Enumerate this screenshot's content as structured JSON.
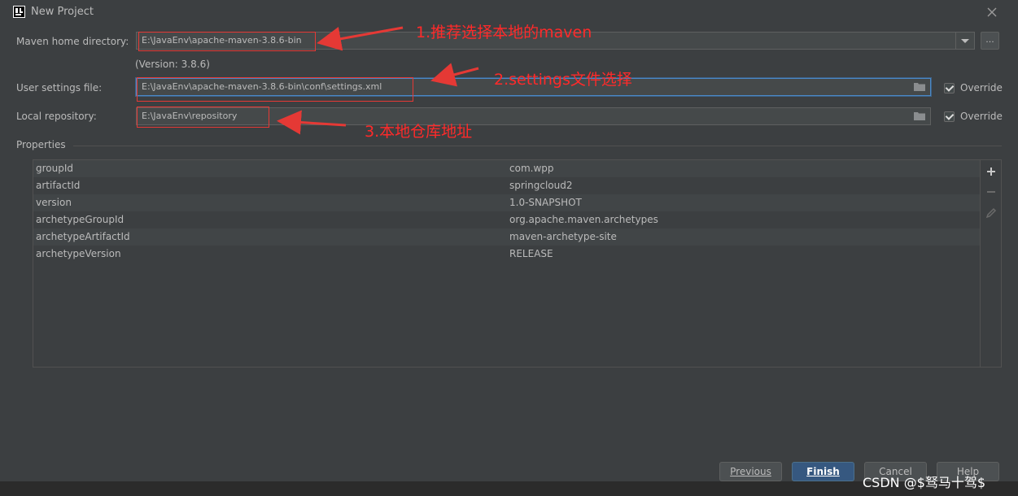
{
  "window": {
    "title": "New Project"
  },
  "maven_home": {
    "label": "Maven home directory:",
    "value": "E:\\JavaEnv\\apache-maven-3.8.6-bin",
    "version": "(Version: 3.8.6)",
    "browse_label": "..."
  },
  "user_settings": {
    "label": "User settings file:",
    "value": "E:\\JavaEnv\\apache-maven-3.8.6-bin\\conf\\settings.xml",
    "override_label": "Override",
    "override_checked": true
  },
  "local_repo": {
    "label": "Local repository:",
    "value": "E:\\JavaEnv\\repository",
    "override_label": "Override",
    "override_checked": true
  },
  "properties": {
    "label": "Properties",
    "rows": [
      {
        "key": "groupId",
        "value": "com.wpp"
      },
      {
        "key": "artifactId",
        "value": "springcloud2"
      },
      {
        "key": "version",
        "value": "1.0-SNAPSHOT"
      },
      {
        "key": "archetypeGroupId",
        "value": "org.apache.maven.archetypes"
      },
      {
        "key": "archetypeArtifactId",
        "value": "maven-archetype-site"
      },
      {
        "key": "archetypeVersion",
        "value": "RELEASE"
      }
    ]
  },
  "annotations": {
    "note1": "1.推荐选择本地的maven",
    "note2": "2.settings文件选择",
    "note3": "3.本地仓库地址",
    "color": "#ff2a2a"
  },
  "buttons": {
    "previous": "Previous",
    "finish": "Finish",
    "cancel": "Cancel",
    "help": "Help"
  },
  "watermark": "CSDN @$驽马十驾$",
  "colors": {
    "background": "#3c3f41",
    "field": "#45494a",
    "primary": "#365880",
    "focus": "#4a88c7"
  }
}
